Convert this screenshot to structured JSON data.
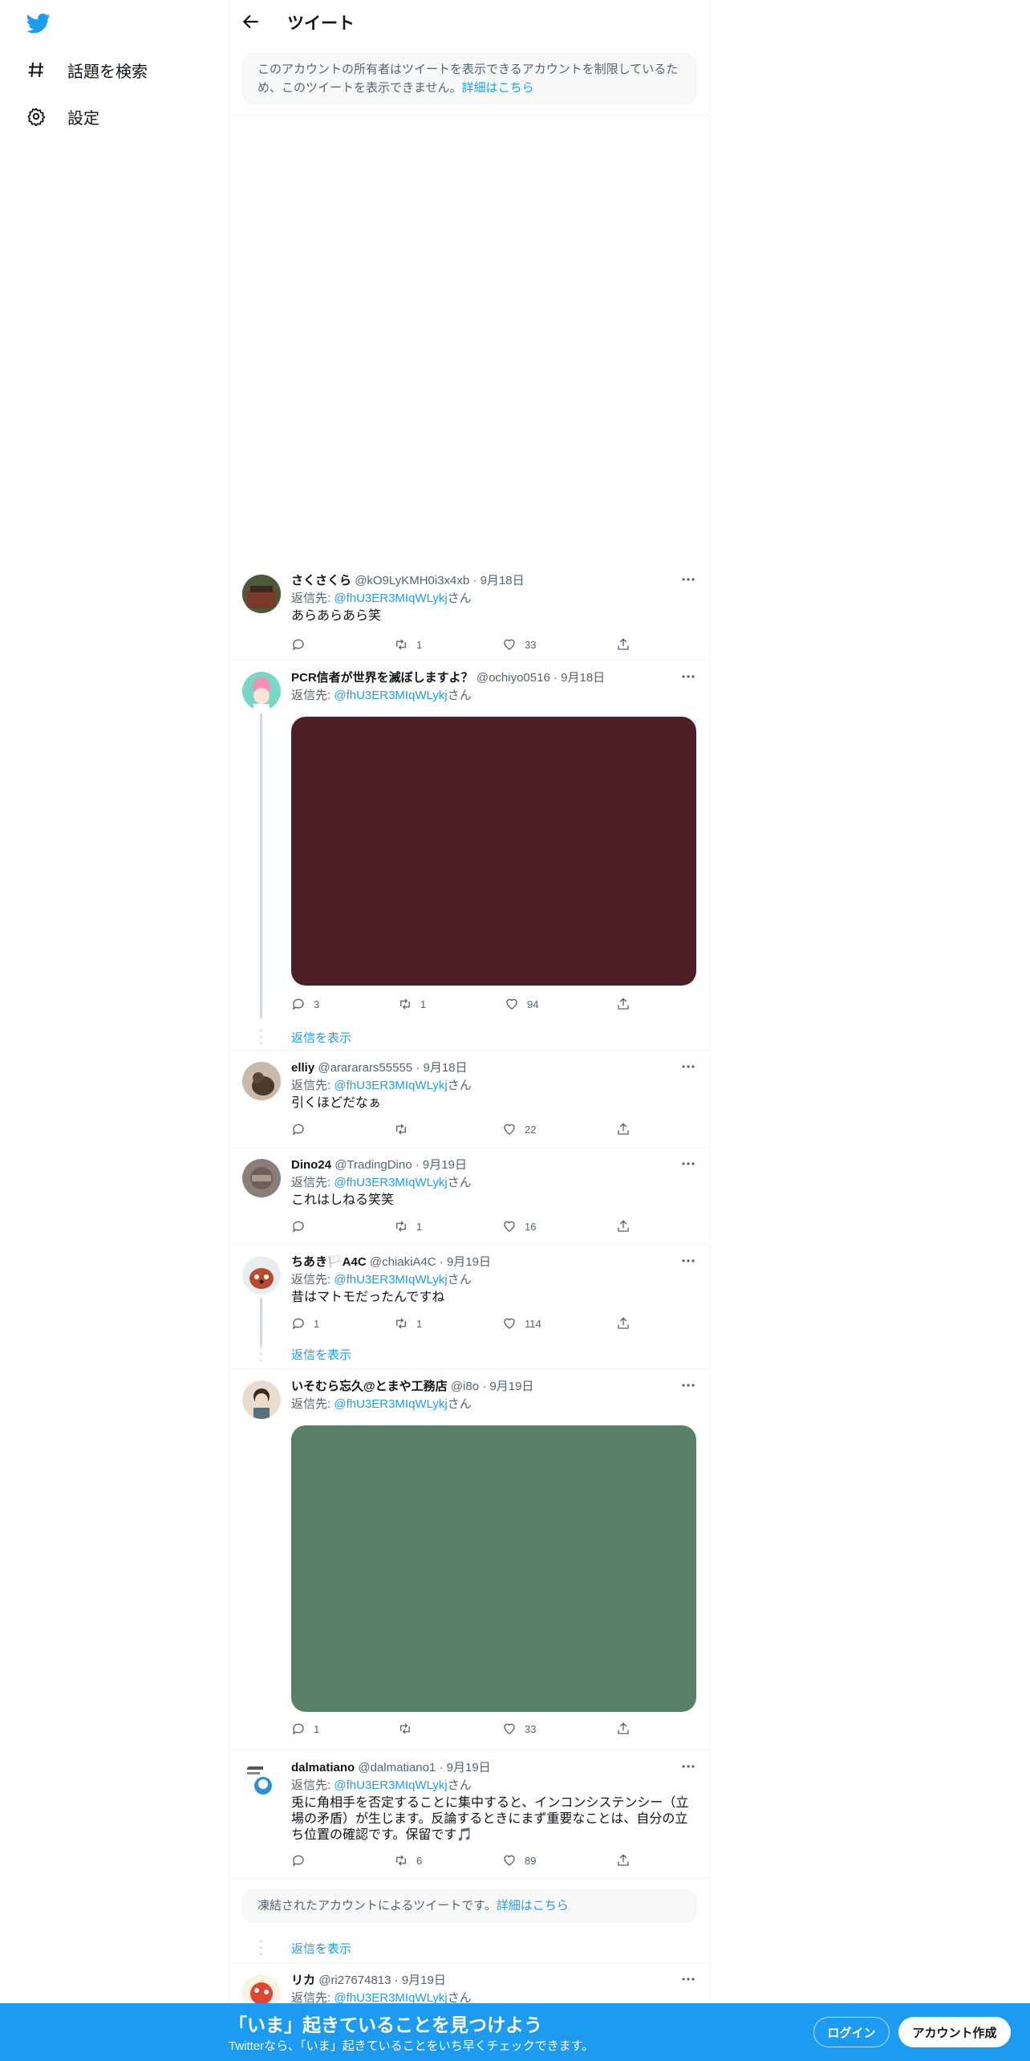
{
  "nav": {
    "explore_label": "話題を検索",
    "settings_label": "設定"
  },
  "header": {
    "title": "ツイート"
  },
  "notice_restricted": {
    "text": "このアカウントの所有者はツイートを表示できるアカウントを制限しているため、このツイートを表示できません。",
    "link": "詳細はこちら"
  },
  "reply_prefix": "返信先: ",
  "reply_suffix": "さん",
  "show_replies": "返信を表示",
  "tweets": [
    {
      "name": "さくさくら",
      "handle": "@kO9LyKMH0i3x4xb",
      "date": "9月18日",
      "reply_to": "@fhU3ER3MIqWLykj",
      "text": "あらあらあら笑",
      "replies": "",
      "retweets": "1",
      "likes": "33"
    },
    {
      "name": "PCR信者が世界を滅ぼしますよ？",
      "handle": "@ochiyo0516",
      "date": "9月18日",
      "reply_to": "@fhU3ER3MIqWLykj",
      "text": "",
      "replies": "3",
      "retweets": "1",
      "likes": "94",
      "media_color": "#4f1f28"
    },
    {
      "name": "elliy",
      "handle": "@arararars55555",
      "date": "9月18日",
      "reply_to": "@fhU3ER3MIqWLykj",
      "text": "引くほどだなぁ",
      "replies": "",
      "retweets": "",
      "likes": "22"
    },
    {
      "name": "Dino24",
      "handle": "@TradingDino",
      "date": "9月19日",
      "reply_to": "@fhU3ER3MIqWLykj",
      "text": "これはしねる笑笑",
      "replies": "",
      "retweets": "1",
      "likes": "16"
    },
    {
      "name": "ちあき🏳️A4C",
      "handle": "@chiakiA4C",
      "date": "9月19日",
      "reply_to": "@fhU3ER3MIqWLykj",
      "text": "昔はマトモだったんですね",
      "replies": "1",
      "retweets": "1",
      "likes": "114"
    },
    {
      "name": "いそむら忘久@とまや工務店",
      "handle": "@i8o",
      "date": "9月19日",
      "reply_to": "@fhU3ER3MIqWLykj",
      "text": "",
      "replies": "1",
      "retweets": "",
      "likes": "33",
      "media_color": "#5a7f67"
    },
    {
      "name": "dalmatiano",
      "handle": "@dalmatiano1",
      "date": "9月19日",
      "reply_to": "@fhU3ER3MIqWLykj",
      "text": "兎に角相手を否定することに集中すると、インコンシステンシー（立場の矛盾）が生じます。反論するときにまず重要なことは、自分の立ち位置の確認です。保留です🎵",
      "replies": "",
      "retweets": "6",
      "likes": "89"
    },
    {
      "name": "リカ",
      "handle": "@ri27674813",
      "date": "9月19日",
      "reply_to": "@fhU3ER3MIqWLykj",
      "text": "",
      "replies": "",
      "retweets": "",
      "likes": ""
    }
  ],
  "notice_suspended": {
    "text": "凍結されたアカウントによるツイートです。",
    "link": "詳細はこちら"
  },
  "bottom_bar": {
    "title": "「いま」起きていることを見つけよう",
    "subtitle": "Twitterなら、「いま」起きていることをいち早くチェックできます。",
    "login": "ログイン",
    "signup": "アカウント作成"
  },
  "colors": {
    "accent": "#1d9bf0"
  }
}
